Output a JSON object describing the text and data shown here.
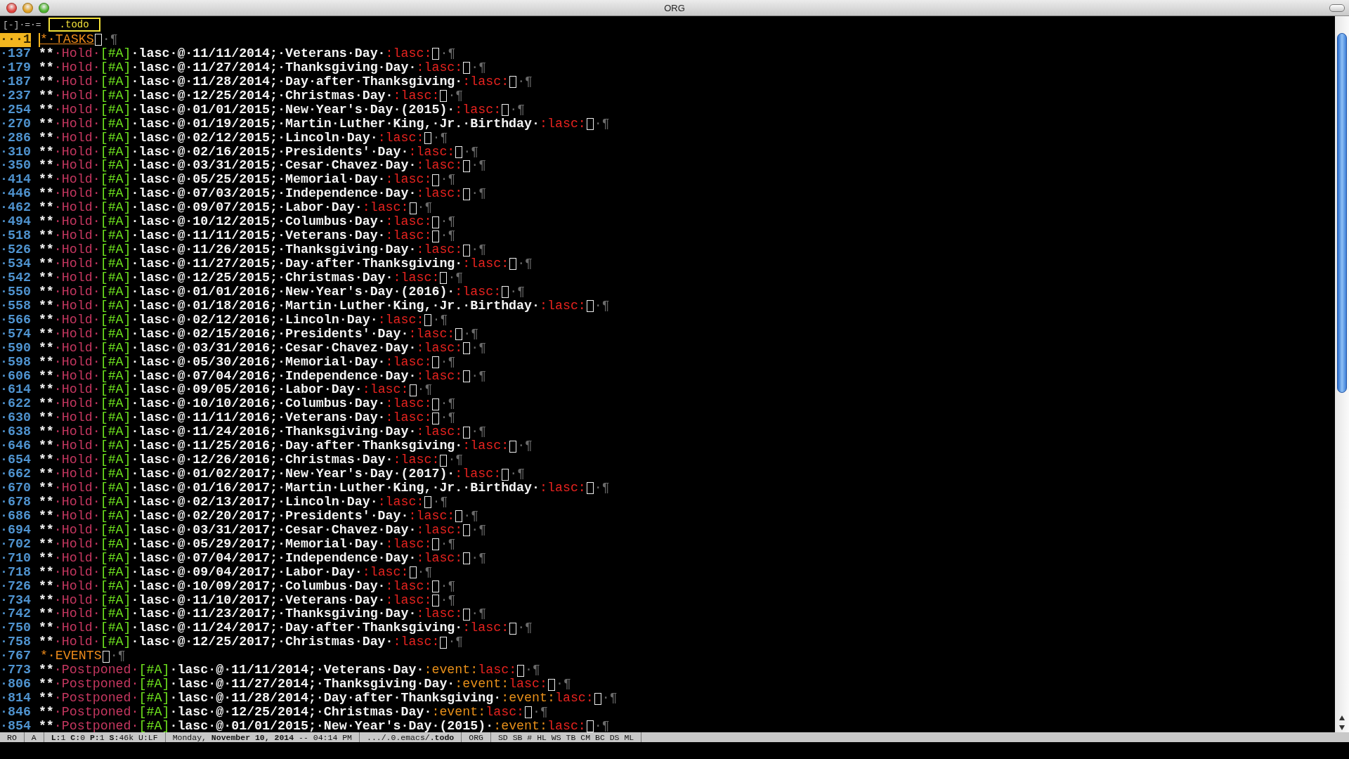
{
  "window": {
    "title": "ORG"
  },
  "header": {
    "prefix": "[-]·=·=",
    "buffer": ".todo"
  },
  "lines": [
    {
      "kind": "heading",
      "current": true,
      "number": "···1",
      "marker": "*·TASKS",
      "end": "·¶"
    },
    {
      "kind": "task",
      "current": false,
      "number": "·137",
      "marker": "**",
      "keyword": "·Hold·",
      "priority": "[#A]",
      "title": "·lasc·@·11/11/2014;·Veterans·Day·",
      "tags": [
        {
          "text": ":lasc:",
          "color": "#e8231f"
        }
      ],
      "end": "·¶"
    },
    {
      "kind": "task",
      "current": false,
      "number": "·179",
      "marker": "**",
      "keyword": "·Hold·",
      "priority": "[#A]",
      "title": "·lasc·@·11/27/2014;·Thanksgiving·Day·",
      "tags": [
        {
          "text": ":lasc:",
          "color": "#e8231f"
        }
      ],
      "end": "·¶"
    },
    {
      "kind": "task",
      "current": false,
      "number": "·187",
      "marker": "**",
      "keyword": "·Hold·",
      "priority": "[#A]",
      "title": "·lasc·@·11/28/2014;·Day·after·Thanksgiving·",
      "tags": [
        {
          "text": ":lasc:",
          "color": "#e8231f"
        }
      ],
      "end": "·¶"
    },
    {
      "kind": "task",
      "current": false,
      "number": "·237",
      "marker": "**",
      "keyword": "·Hold·",
      "priority": "[#A]",
      "title": "·lasc·@·12/25/2014;·Christmas·Day·",
      "tags": [
        {
          "text": ":lasc:",
          "color": "#e8231f"
        }
      ],
      "end": "·¶"
    },
    {
      "kind": "task",
      "current": false,
      "number": "·254",
      "marker": "**",
      "keyword": "·Hold·",
      "priority": "[#A]",
      "title": "·lasc·@·01/01/2015;·New·Year's·Day·(2015)·",
      "tags": [
        {
          "text": ":lasc:",
          "color": "#e8231f"
        }
      ],
      "end": "·¶"
    },
    {
      "kind": "task",
      "current": false,
      "number": "·270",
      "marker": "**",
      "keyword": "·Hold·",
      "priority": "[#A]",
      "title": "·lasc·@·01/19/2015;·Martin·Luther·King,·Jr.·Birthday·",
      "tags": [
        {
          "text": ":lasc:",
          "color": "#e8231f"
        }
      ],
      "end": "·¶"
    },
    {
      "kind": "task",
      "current": false,
      "number": "·286",
      "marker": "**",
      "keyword": "·Hold·",
      "priority": "[#A]",
      "title": "·lasc·@·02/12/2015;·Lincoln·Day·",
      "tags": [
        {
          "text": ":lasc:",
          "color": "#e8231f"
        }
      ],
      "end": "·¶"
    },
    {
      "kind": "task",
      "current": false,
      "number": "·310",
      "marker": "**",
      "keyword": "·Hold·",
      "priority": "[#A]",
      "title": "·lasc·@·02/16/2015;·Presidents'·Day·",
      "tags": [
        {
          "text": ":lasc:",
          "color": "#e8231f"
        }
      ],
      "end": "·¶"
    },
    {
      "kind": "task",
      "current": false,
      "number": "·350",
      "marker": "**",
      "keyword": "·Hold·",
      "priority": "[#A]",
      "title": "·lasc·@·03/31/2015;·Cesar·Chavez·Day·",
      "tags": [
        {
          "text": ":lasc:",
          "color": "#e8231f"
        }
      ],
      "end": "·¶"
    },
    {
      "kind": "task",
      "current": false,
      "number": "·414",
      "marker": "**",
      "keyword": "·Hold·",
      "priority": "[#A]",
      "title": "·lasc·@·05/25/2015;·Memorial·Day·",
      "tags": [
        {
          "text": ":lasc:",
          "color": "#e8231f"
        }
      ],
      "end": "·¶"
    },
    {
      "kind": "task",
      "current": false,
      "number": "·446",
      "marker": "**",
      "keyword": "·Hold·",
      "priority": "[#A]",
      "title": "·lasc·@·07/03/2015;·Independence·Day·",
      "tags": [
        {
          "text": ":lasc:",
          "color": "#e8231f"
        }
      ],
      "end": "·¶"
    },
    {
      "kind": "task",
      "current": false,
      "number": "·462",
      "marker": "**",
      "keyword": "·Hold·",
      "priority": "[#A]",
      "title": "·lasc·@·09/07/2015;·Labor·Day·",
      "tags": [
        {
          "text": ":lasc:",
          "color": "#e8231f"
        }
      ],
      "end": "·¶"
    },
    {
      "kind": "task",
      "current": false,
      "number": "·494",
      "marker": "**",
      "keyword": "·Hold·",
      "priority": "[#A]",
      "title": "·lasc·@·10/12/2015;·Columbus·Day·",
      "tags": [
        {
          "text": ":lasc:",
          "color": "#e8231f"
        }
      ],
      "end": "·¶"
    },
    {
      "kind": "task",
      "current": false,
      "number": "·518",
      "marker": "**",
      "keyword": "·Hold·",
      "priority": "[#A]",
      "title": "·lasc·@·11/11/2015;·Veterans·Day·",
      "tags": [
        {
          "text": ":lasc:",
          "color": "#e8231f"
        }
      ],
      "end": "·¶"
    },
    {
      "kind": "task",
      "current": false,
      "number": "·526",
      "marker": "**",
      "keyword": "·Hold·",
      "priority": "[#A]",
      "title": "·lasc·@·11/26/2015;·Thanksgiving·Day·",
      "tags": [
        {
          "text": ":lasc:",
          "color": "#e8231f"
        }
      ],
      "end": "·¶"
    },
    {
      "kind": "task",
      "current": false,
      "number": "·534",
      "marker": "**",
      "keyword": "·Hold·",
      "priority": "[#A]",
      "title": "·lasc·@·11/27/2015;·Day·after·Thanksgiving·",
      "tags": [
        {
          "text": ":lasc:",
          "color": "#e8231f"
        }
      ],
      "end": "·¶"
    },
    {
      "kind": "task",
      "current": false,
      "number": "·542",
      "marker": "**",
      "keyword": "·Hold·",
      "priority": "[#A]",
      "title": "·lasc·@·12/25/2015;·Christmas·Day·",
      "tags": [
        {
          "text": ":lasc:",
          "color": "#e8231f"
        }
      ],
      "end": "·¶"
    },
    {
      "kind": "task",
      "current": false,
      "number": "·550",
      "marker": "**",
      "keyword": "·Hold·",
      "priority": "[#A]",
      "title": "·lasc·@·01/01/2016;·New·Year's·Day·(2016)·",
      "tags": [
        {
          "text": ":lasc:",
          "color": "#e8231f"
        }
      ],
      "end": "·¶"
    },
    {
      "kind": "task",
      "current": false,
      "number": "·558",
      "marker": "**",
      "keyword": "·Hold·",
      "priority": "[#A]",
      "title": "·lasc·@·01/18/2016;·Martin·Luther·King,·Jr.·Birthday·",
      "tags": [
        {
          "text": ":lasc:",
          "color": "#e8231f"
        }
      ],
      "end": "·¶"
    },
    {
      "kind": "task",
      "current": false,
      "number": "·566",
      "marker": "**",
      "keyword": "·Hold·",
      "priority": "[#A]",
      "title": "·lasc·@·02/12/2016;·Lincoln·Day·",
      "tags": [
        {
          "text": ":lasc:",
          "color": "#e8231f"
        }
      ],
      "end": "·¶"
    },
    {
      "kind": "task",
      "current": false,
      "number": "·574",
      "marker": "**",
      "keyword": "·Hold·",
      "priority": "[#A]",
      "title": "·lasc·@·02/15/2016;·Presidents'·Day·",
      "tags": [
        {
          "text": ":lasc:",
          "color": "#e8231f"
        }
      ],
      "end": "·¶"
    },
    {
      "kind": "task",
      "current": false,
      "number": "·590",
      "marker": "**",
      "keyword": "·Hold·",
      "priority": "[#A]",
      "title": "·lasc·@·03/31/2016;·Cesar·Chavez·Day·",
      "tags": [
        {
          "text": ":lasc:",
          "color": "#e8231f"
        }
      ],
      "end": "·¶"
    },
    {
      "kind": "task",
      "current": false,
      "number": "·598",
      "marker": "**",
      "keyword": "·Hold·",
      "priority": "[#A]",
      "title": "·lasc·@·05/30/2016;·Memorial·Day·",
      "tags": [
        {
          "text": ":lasc:",
          "color": "#e8231f"
        }
      ],
      "end": "·¶"
    },
    {
      "kind": "task",
      "current": false,
      "number": "·606",
      "marker": "**",
      "keyword": "·Hold·",
      "priority": "[#A]",
      "title": "·lasc·@·07/04/2016;·Independence·Day·",
      "tags": [
        {
          "text": ":lasc:",
          "color": "#e8231f"
        }
      ],
      "end": "·¶"
    },
    {
      "kind": "task",
      "current": false,
      "number": "·614",
      "marker": "**",
      "keyword": "·Hold·",
      "priority": "[#A]",
      "title": "·lasc·@·09/05/2016;·Labor·Day·",
      "tags": [
        {
          "text": ":lasc:",
          "color": "#e8231f"
        }
      ],
      "end": "·¶"
    },
    {
      "kind": "task",
      "current": false,
      "number": "·622",
      "marker": "**",
      "keyword": "·Hold·",
      "priority": "[#A]",
      "title": "·lasc·@·10/10/2016;·Columbus·Day·",
      "tags": [
        {
          "text": ":lasc:",
          "color": "#e8231f"
        }
      ],
      "end": "·¶"
    },
    {
      "kind": "task",
      "current": false,
      "number": "·630",
      "marker": "**",
      "keyword": "·Hold·",
      "priority": "[#A]",
      "title": "·lasc·@·11/11/2016;·Veterans·Day·",
      "tags": [
        {
          "text": ":lasc:",
          "color": "#e8231f"
        }
      ],
      "end": "·¶"
    },
    {
      "kind": "task",
      "current": false,
      "number": "·638",
      "marker": "**",
      "keyword": "·Hold·",
      "priority": "[#A]",
      "title": "·lasc·@·11/24/2016;·Thanksgiving·Day·",
      "tags": [
        {
          "text": ":lasc:",
          "color": "#e8231f"
        }
      ],
      "end": "·¶"
    },
    {
      "kind": "task",
      "current": false,
      "number": "·646",
      "marker": "**",
      "keyword": "·Hold·",
      "priority": "[#A]",
      "title": "·lasc·@·11/25/2016;·Day·after·Thanksgiving·",
      "tags": [
        {
          "text": ":lasc:",
          "color": "#e8231f"
        }
      ],
      "end": "·¶"
    },
    {
      "kind": "task",
      "current": false,
      "number": "·654",
      "marker": "**",
      "keyword": "·Hold·",
      "priority": "[#A]",
      "title": "·lasc·@·12/26/2016;·Christmas·Day·",
      "tags": [
        {
          "text": ":lasc:",
          "color": "#e8231f"
        }
      ],
      "end": "·¶"
    },
    {
      "kind": "task",
      "current": false,
      "number": "·662",
      "marker": "**",
      "keyword": "·Hold·",
      "priority": "[#A]",
      "title": "·lasc·@·01/02/2017;·New·Year's·Day·(2017)·",
      "tags": [
        {
          "text": ":lasc:",
          "color": "#e8231f"
        }
      ],
      "end": "·¶"
    },
    {
      "kind": "task",
      "current": false,
      "number": "·670",
      "marker": "**",
      "keyword": "·Hold·",
      "priority": "[#A]",
      "title": "·lasc·@·01/16/2017;·Martin·Luther·King,·Jr.·Birthday·",
      "tags": [
        {
          "text": ":lasc:",
          "color": "#e8231f"
        }
      ],
      "end": "·¶"
    },
    {
      "kind": "task",
      "current": false,
      "number": "·678",
      "marker": "**",
      "keyword": "·Hold·",
      "priority": "[#A]",
      "title": "·lasc·@·02/13/2017;·Lincoln·Day·",
      "tags": [
        {
          "text": ":lasc:",
          "color": "#e8231f"
        }
      ],
      "end": "·¶"
    },
    {
      "kind": "task",
      "current": false,
      "number": "·686",
      "marker": "**",
      "keyword": "·Hold·",
      "priority": "[#A]",
      "title": "·lasc·@·02/20/2017;·Presidents'·Day·",
      "tags": [
        {
          "text": ":lasc:",
          "color": "#e8231f"
        }
      ],
      "end": "·¶"
    },
    {
      "kind": "task",
      "current": false,
      "number": "·694",
      "marker": "**",
      "keyword": "·Hold·",
      "priority": "[#A]",
      "title": "·lasc·@·03/31/2017;·Cesar·Chavez·Day·",
      "tags": [
        {
          "text": ":lasc:",
          "color": "#e8231f"
        }
      ],
      "end": "·¶"
    },
    {
      "kind": "task",
      "current": false,
      "number": "·702",
      "marker": "**",
      "keyword": "·Hold·",
      "priority": "[#A]",
      "title": "·lasc·@·05/29/2017;·Memorial·Day·",
      "tags": [
        {
          "text": ":lasc:",
          "color": "#e8231f"
        }
      ],
      "end": "·¶"
    },
    {
      "kind": "task",
      "current": false,
      "number": "·710",
      "marker": "**",
      "keyword": "·Hold·",
      "priority": "[#A]",
      "title": "·lasc·@·07/04/2017;·Independence·Day·",
      "tags": [
        {
          "text": ":lasc:",
          "color": "#e8231f"
        }
      ],
      "end": "·¶"
    },
    {
      "kind": "task",
      "current": false,
      "number": "·718",
      "marker": "**",
      "keyword": "·Hold·",
      "priority": "[#A]",
      "title": "·lasc·@·09/04/2017;·Labor·Day·",
      "tags": [
        {
          "text": ":lasc:",
          "color": "#e8231f"
        }
      ],
      "end": "·¶"
    },
    {
      "kind": "task",
      "current": false,
      "number": "·726",
      "marker": "**",
      "keyword": "·Hold·",
      "priority": "[#A]",
      "title": "·lasc·@·10/09/2017;·Columbus·Day·",
      "tags": [
        {
          "text": ":lasc:",
          "color": "#e8231f"
        }
      ],
      "end": "·¶"
    },
    {
      "kind": "task",
      "current": false,
      "number": "·734",
      "marker": "**",
      "keyword": "·Hold·",
      "priority": "[#A]",
      "title": "·lasc·@·11/10/2017;·Veterans·Day·",
      "tags": [
        {
          "text": ":lasc:",
          "color": "#e8231f"
        }
      ],
      "end": "·¶"
    },
    {
      "kind": "task",
      "current": false,
      "number": "·742",
      "marker": "**",
      "keyword": "·Hold·",
      "priority": "[#A]",
      "title": "·lasc·@·11/23/2017;·Thanksgiving·Day·",
      "tags": [
        {
          "text": ":lasc:",
          "color": "#e8231f"
        }
      ],
      "end": "·¶"
    },
    {
      "kind": "task",
      "current": false,
      "number": "·750",
      "marker": "**",
      "keyword": "·Hold·",
      "priority": "[#A]",
      "title": "·lasc·@·11/24/2017;·Day·after·Thanksgiving·",
      "tags": [
        {
          "text": ":lasc:",
          "color": "#e8231f"
        }
      ],
      "end": "·¶"
    },
    {
      "kind": "task",
      "current": false,
      "number": "·758",
      "marker": "**",
      "keyword": "·Hold·",
      "priority": "[#A]",
      "title": "·lasc·@·12/25/2017;·Christmas·Day·",
      "tags": [
        {
          "text": ":lasc:",
          "color": "#e8231f"
        }
      ],
      "end": "·¶"
    },
    {
      "kind": "heading",
      "current": false,
      "number": "·767",
      "marker": "*·EVENTS",
      "end": "·¶"
    },
    {
      "kind": "task",
      "current": false,
      "number": "·773",
      "marker": "**",
      "keyword": "·Postponed·",
      "priority": "[#A]",
      "title": "·lasc·@·11/11/2014;·Veterans·Day·",
      "tags": [
        {
          "text": ":event:",
          "color": "#e8901a"
        },
        {
          "text": "lasc:",
          "color": "#e8231f"
        }
      ],
      "end": "·¶"
    },
    {
      "kind": "task",
      "current": false,
      "number": "·806",
      "marker": "**",
      "keyword": "·Postponed·",
      "priority": "[#A]",
      "title": "·lasc·@·11/27/2014;·Thanksgiving·Day·",
      "tags": [
        {
          "text": ":event:",
          "color": "#e8901a"
        },
        {
          "text": "lasc:",
          "color": "#e8231f"
        }
      ],
      "end": "·¶"
    },
    {
      "kind": "task",
      "current": false,
      "number": "·814",
      "marker": "**",
      "keyword": "·Postponed·",
      "priority": "[#A]",
      "title": "·lasc·@·11/28/2014;·Day·after·Thanksgiving·",
      "tags": [
        {
          "text": ":event:",
          "color": "#e8901a"
        },
        {
          "text": "lasc:",
          "color": "#e8231f"
        }
      ],
      "end": "·¶"
    },
    {
      "kind": "task",
      "current": false,
      "number": "·846",
      "marker": "**",
      "keyword": "·Postponed·",
      "priority": "[#A]",
      "title": "·lasc·@·12/25/2014;·Christmas·Day·",
      "tags": [
        {
          "text": ":event:",
          "color": "#e8901a"
        },
        {
          "text": "lasc:",
          "color": "#e8231f"
        }
      ],
      "end": "·¶"
    },
    {
      "kind": "task",
      "current": false,
      "number": "·854",
      "marker": "**",
      "keyword": "·Postponed·",
      "priority": "[#A]",
      "title": "·lasc·@·01/01/2015;·New·Year's·Day·(2015)·",
      "tags": [
        {
          "text": ":event:",
          "color": "#e8901a"
        },
        {
          "text": "lasc:",
          "color": "#e8231f"
        }
      ],
      "end": "·¶"
    }
  ],
  "status_bar": [
    "RO",
    "A",
    "**L:**1 **C:**0 **P:**1 **S:**46k U:LF",
    "Monday, **November 10, 2014** -- 04:14 PM",
    ".../.0.emacs/**.todo**",
    "ORG",
    "SD SB # HL WS TB CM BC DS ML"
  ]
}
